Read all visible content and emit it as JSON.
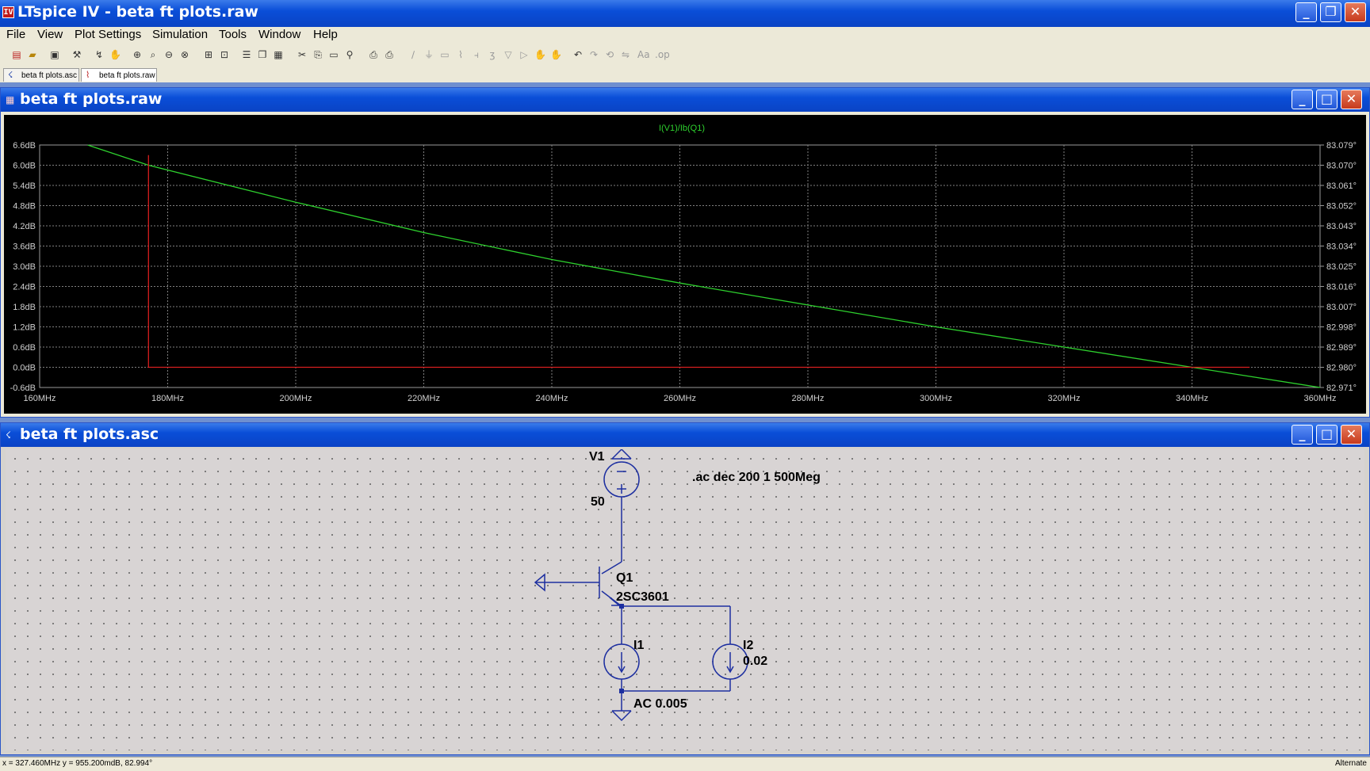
{
  "app": {
    "title": "LTspice IV - beta ft plots.raw",
    "menu": [
      "File",
      "View",
      "Plot Settings",
      "Simulation",
      "Tools",
      "Window",
      "Help"
    ],
    "tabs": [
      {
        "label": "beta ft plots.asc",
        "active": false
      },
      {
        "label": "beta ft plots.raw",
        "active": true
      }
    ]
  },
  "plot_window": {
    "title": "beta ft plots.raw",
    "trace_label": "I(V1)/Ib(Q1)"
  },
  "chart_data": {
    "type": "line",
    "title": "I(V1)/Ib(Q1)",
    "x_ticks": [
      "160MHz",
      "180MHz",
      "200MHz",
      "220MHz",
      "240MHz",
      "260MHz",
      "280MHz",
      "300MHz",
      "320MHz",
      "340MHz",
      "360MHz"
    ],
    "left_ticks": [
      "6.6dB",
      "6.0dB",
      "5.4dB",
      "4.8dB",
      "4.2dB",
      "3.6dB",
      "3.0dB",
      "2.4dB",
      "1.8dB",
      "1.2dB",
      "0.6dB",
      "0.0dB",
      "-0.6dB"
    ],
    "right_ticks": [
      "83.079°",
      "83.070°",
      "83.061°",
      "83.052°",
      "83.043°",
      "83.034°",
      "83.025°",
      "83.016°",
      "83.007°",
      "82.998°",
      "82.989°",
      "82.980°",
      "82.971°"
    ],
    "xlim": [
      160,
      360
    ],
    "ylim_db": [
      -0.6,
      6.6
    ],
    "grid": true,
    "series": [
      {
        "name": "I(V1)/Ib(Q1)",
        "color": "#2ed12e",
        "x": [
          167.5,
          177,
          200,
          220,
          240,
          260,
          280,
          300,
          320,
          340,
          360
        ],
        "y": [
          6.6,
          6.0,
          4.9,
          4.0,
          3.2,
          2.5,
          1.85,
          1.2,
          0.6,
          0.0,
          -0.6
        ]
      },
      {
        "name": "",
        "color": "#d81e1e",
        "x": [
          177,
          177,
          349
        ],
        "y": [
          6.3,
          0.0,
          0.0
        ]
      }
    ],
    "cursor_step_x": 177
  },
  "schematic": {
    "title": "beta ft plots.asc",
    "directive": ".ac dec 200 1 500Meg",
    "labels": {
      "v1_name": "V1",
      "v1_value": "50",
      "q1_name": "Q1",
      "q1_model": "2SC3601",
      "i1_name": "I1",
      "i1_value": "AC 0.005",
      "i2_name": "I2",
      "i2_value": "0.02"
    },
    "wire_color": "#1d2fa0"
  },
  "status": {
    "readout": "x = 327.460MHz    y = 955.200mdB, 82.994°",
    "mode": "Alternate"
  }
}
